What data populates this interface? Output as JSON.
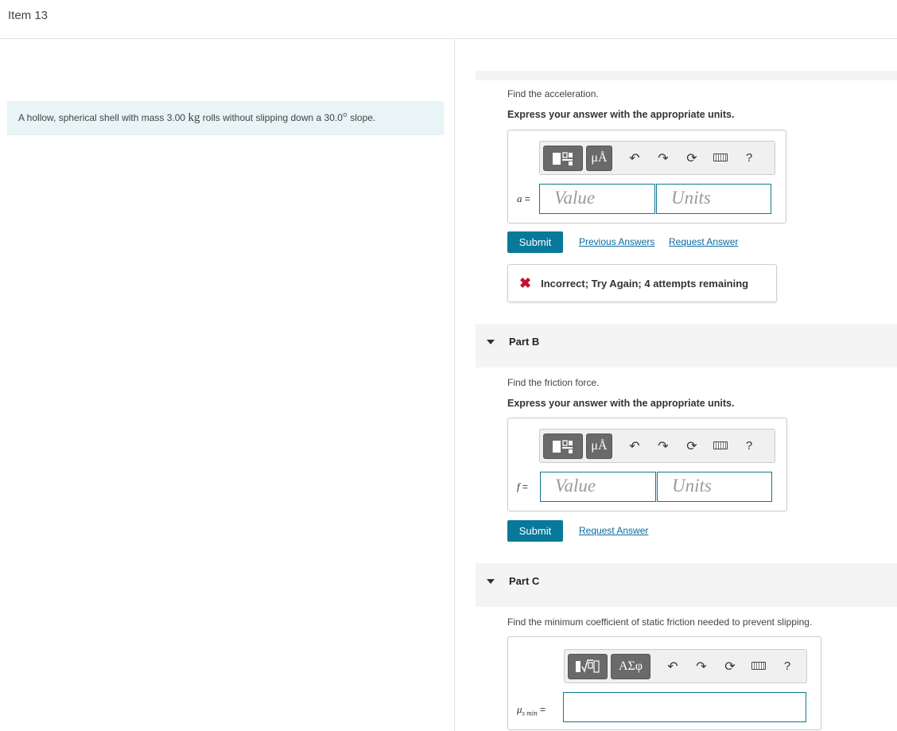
{
  "item": {
    "title": "Item 13"
  },
  "problem": {
    "pre": "A hollow, spherical shell with mass 3.00 ",
    "mass_unit": "kg",
    "mid": " rolls without slipping down a 30.0",
    "degree": "°",
    "post": " slope."
  },
  "toolbar_icons": {
    "templates": "templates-icon",
    "units": "mu-angstrom-icon",
    "greek": "greek-alpha-sigma-phi-icon",
    "undo": "undo-icon",
    "redo": "redo-icon",
    "reset": "reset-icon",
    "keyboard": "keyboard-icon",
    "help": "help-icon"
  },
  "partA": {
    "prompt": "Find the acceleration.",
    "instruction": "Express your answer with the appropriate units.",
    "units_button": "μÅ",
    "help": "?",
    "variable": "a",
    "equals": "=",
    "value_placeholder": "Value",
    "units_placeholder": "Units",
    "submit": "Submit",
    "previous_answers": "Previous Answers",
    "request_answer": "Request Answer",
    "feedback": "Incorrect; Try Again; 4 attempts remaining",
    "feedback_icon": "✖"
  },
  "partB": {
    "label": "Part B",
    "prompt": "Find the friction force.",
    "instruction": "Express your answer with the appropriate units.",
    "units_button": "μÅ",
    "help": "?",
    "variable": "f",
    "equals": "=",
    "value_placeholder": "Value",
    "units_placeholder": "Units",
    "submit": "Submit",
    "request_answer": "Request Answer"
  },
  "partC": {
    "label": "Part C",
    "prompt": "Find the minimum coefficient of static friction needed to prevent slipping.",
    "greek_button": "ΑΣφ",
    "help": "?",
    "variable_main": "μ",
    "variable_sub": "s min",
    "equals": "="
  },
  "colors": {
    "accent": "#08799b",
    "error": "#c8102e",
    "field_border": "#0e7a8e"
  }
}
